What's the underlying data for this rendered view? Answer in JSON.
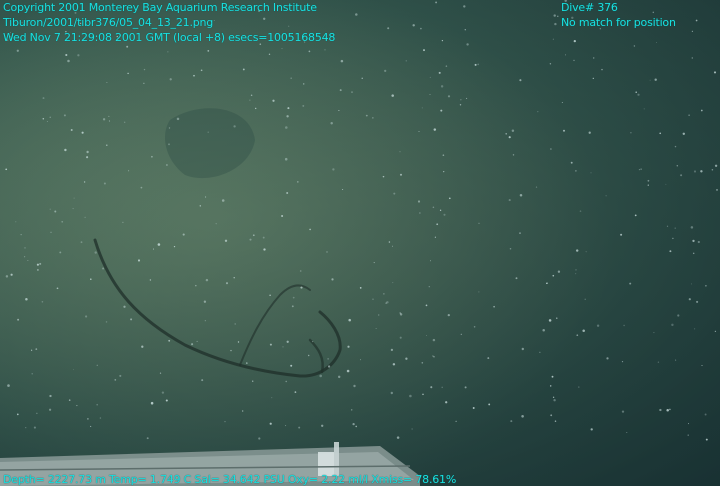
{
  "overlay": {
    "top_left": [
      "Copyright 2001 Monterey Bay Aquarium Research Institute",
      "Tiburon/2001/tibr376/05_04_13_21.png",
      "Wed Nov  7 21:29:08 2001 GMT (local +8)  esecs=1005168548"
    ],
    "top_right": [
      "Dive# 376",
      "No match for position"
    ],
    "bottom": "Depth= 2227.73 m  Temp= 1.749 C  Sal= 34.642 PSU  Oxy= 2.22 ml/l  Xmiss= 78.61%"
  },
  "colors": {
    "overlay_text": "#19e0e0",
    "water_light": "#5f8068",
    "water_dark": "#203c3a"
  }
}
